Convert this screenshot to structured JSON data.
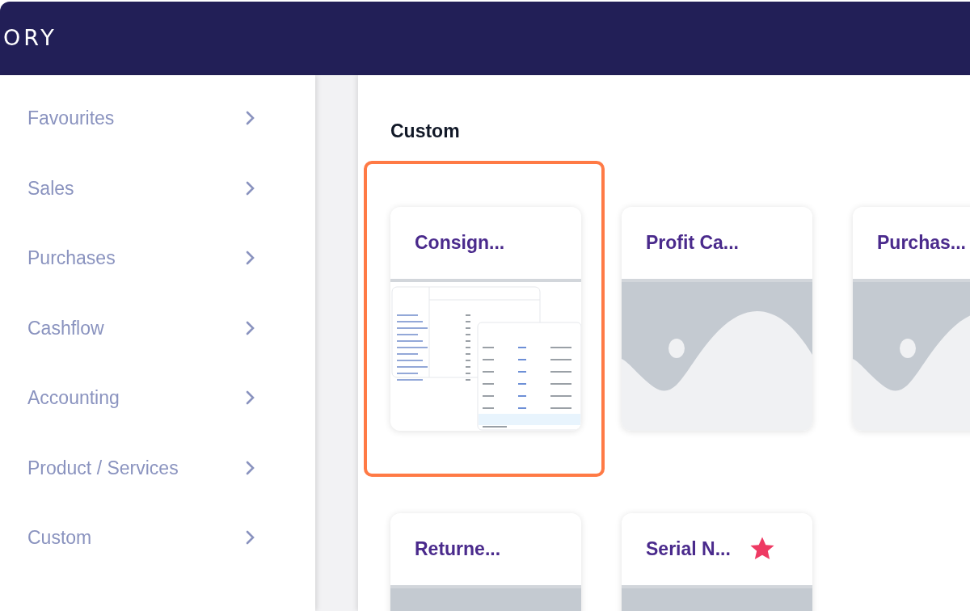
{
  "header": {
    "brand": "ORY"
  },
  "sidebar": {
    "items": [
      {
        "label": "Favourites"
      },
      {
        "label": "Sales"
      },
      {
        "label": "Purchases"
      },
      {
        "label": "Cashflow"
      },
      {
        "label": "Accounting"
      },
      {
        "label": "Product / Services"
      },
      {
        "label": "Custom"
      }
    ]
  },
  "section": {
    "title": "Custom",
    "cards": [
      {
        "title": "Consign...",
        "kind": "report",
        "favourite": false,
        "highlighted": true
      },
      {
        "title": "Profit Ca...",
        "kind": "placeholder",
        "favourite": false,
        "highlighted": false
      },
      {
        "title": "Purchas...",
        "kind": "placeholder",
        "favourite": false,
        "highlighted": false
      },
      {
        "title": "Returne...",
        "kind": "placeholder",
        "favourite": false,
        "highlighted": false
      },
      {
        "title": "Serial N...",
        "kind": "placeholder",
        "favourite": true,
        "highlighted": false
      }
    ]
  }
}
